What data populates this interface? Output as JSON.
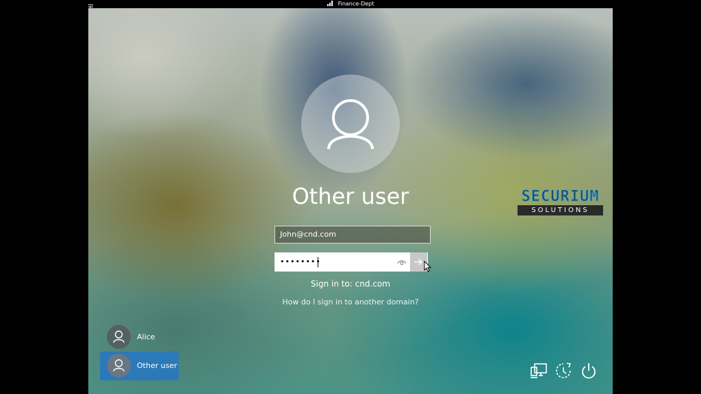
{
  "rdp_bar": {
    "title": "Finance-Dept"
  },
  "lock_screen": {
    "current_user": {
      "display_name": "Other user"
    },
    "email_field": {
      "value": "John@cnd.com"
    },
    "password_field": {
      "value": "••••••••"
    },
    "sign_in_to": "Sign in to: cnd.com",
    "domain_help_link": "How do I sign in to another domain?"
  },
  "brand": {
    "name": "SECURIUM",
    "tagline": "SOLUTIONS"
  },
  "user_switcher": {
    "users": [
      {
        "label": "Alice",
        "selected": false
      },
      {
        "label": "Other user",
        "selected": true
      }
    ]
  },
  "system_icons": [
    "network-icon",
    "ease-of-access-icon",
    "power-icon"
  ],
  "colors": {
    "selected_user_tile": "#2b79b8",
    "brand_text": "#0f4f6e"
  }
}
